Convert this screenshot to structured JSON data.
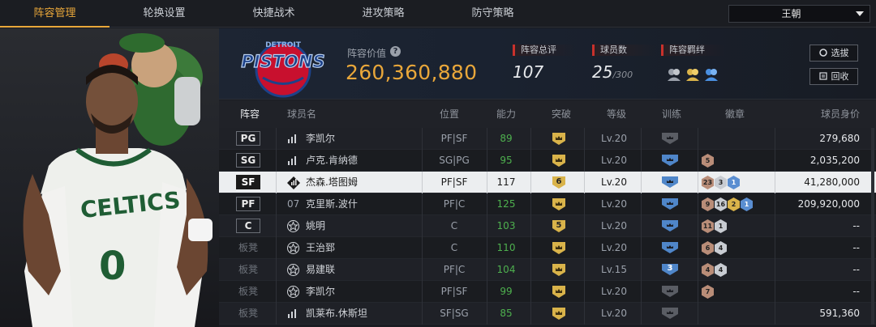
{
  "nav": {
    "tabs": [
      "阵容管理",
      "轮换设置",
      "快捷战术",
      "进攻策略",
      "防守策略"
    ],
    "active_tab": 0,
    "player_select": "王朝"
  },
  "team": {
    "logo_text": "PISTONS",
    "logo_small": "DETROIT"
  },
  "header": {
    "lineup_value_label": "阵容价值",
    "lineup_value": "260,360,880",
    "overall_label": "阵容总评",
    "overall": "107",
    "count_label": "球员数",
    "count": "25",
    "count_max": "/300",
    "bond_label": "阵容羁绊",
    "select_button": "选拔",
    "recycle_button": "回收"
  },
  "columns": {
    "lineup": "阵容",
    "name": "球员名",
    "position": "位置",
    "ability": "能力",
    "breakthrough": "突破",
    "level": "等级",
    "training": "训练",
    "badges": "徽章",
    "value": "球员身价"
  },
  "rows": [
    {
      "slot": "PG",
      "starter": true,
      "icon": "bars",
      "name": "李凯尔",
      "position": "PF|SF",
      "ability": "89",
      "ability_color": "green",
      "breakthrough": "",
      "level": "Lv.20",
      "training": "",
      "training_color": "grey",
      "badges": [],
      "value": "279,680"
    },
    {
      "slot": "SG",
      "starter": true,
      "icon": "bars",
      "name": "卢克.肯纳德",
      "position": "SG|PG",
      "ability": "95",
      "ability_color": "green",
      "breakthrough": "",
      "level": "Lv.20",
      "training": "",
      "training_color": "blue",
      "badges": [
        {
          "t": "5",
          "c": "bronze"
        }
      ],
      "value": "2,035,200"
    },
    {
      "slot": "SF",
      "starter": true,
      "selected": true,
      "icon": "diamond",
      "name": "杰森.塔图姆",
      "position": "PF|SF",
      "ability": "117",
      "ability_color": "white",
      "breakthrough": "6",
      "level": "Lv.20",
      "training": "",
      "training_color": "blue",
      "badges": [
        {
          "t": "23",
          "c": "bronze"
        },
        {
          "t": "3",
          "c": "silver"
        },
        {
          "t": "1",
          "c": "blue"
        }
      ],
      "value": "41,280,000"
    },
    {
      "slot": "PF",
      "starter": true,
      "icon": "07",
      "name": "克里斯.波什",
      "position": "PF|C",
      "ability": "125",
      "ability_color": "green",
      "breakthrough": "",
      "level": "Lv.20",
      "training": "",
      "training_color": "blue",
      "badges": [
        {
          "t": "9",
          "c": "bronze"
        },
        {
          "t": "16",
          "c": "silver"
        },
        {
          "t": "2",
          "c": "gold"
        },
        {
          "t": "1",
          "c": "blue"
        }
      ],
      "value": "209,920,000"
    },
    {
      "slot": "C",
      "starter": true,
      "icon": "star",
      "name": "姚明",
      "position": "C",
      "ability": "103",
      "ability_color": "green",
      "breakthrough": "5",
      "level": "Lv.20",
      "training": "",
      "training_color": "blue",
      "badges": [
        {
          "t": "11",
          "c": "bronze"
        },
        {
          "t": "1",
          "c": "silver"
        }
      ],
      "value": "--"
    },
    {
      "slot": "板凳",
      "starter": false,
      "icon": "star",
      "name": "王治郅",
      "position": "C",
      "ability": "110",
      "ability_color": "green",
      "breakthrough": "",
      "level": "Lv.20",
      "training": "",
      "training_color": "blue",
      "badges": [
        {
          "t": "6",
          "c": "bronze"
        },
        {
          "t": "4",
          "c": "silver"
        }
      ],
      "value": "--"
    },
    {
      "slot": "板凳",
      "starter": false,
      "icon": "star",
      "name": "易建联",
      "position": "PF|C",
      "ability": "104",
      "ability_color": "green",
      "breakthrough": "",
      "level": "Lv.15",
      "training": "3",
      "training_color": "blue",
      "badges": [
        {
          "t": "4",
          "c": "bronze"
        },
        {
          "t": "4",
          "c": "silver"
        }
      ],
      "value": "--"
    },
    {
      "slot": "板凳",
      "starter": false,
      "icon": "star",
      "name": "李凯尔",
      "position": "PF|SF",
      "ability": "99",
      "ability_color": "green",
      "breakthrough": "",
      "level": "Lv.20",
      "training": "",
      "training_color": "grey",
      "badges": [
        {
          "t": "7",
          "c": "bronze"
        }
      ],
      "value": "--"
    },
    {
      "slot": "板凳",
      "starter": false,
      "icon": "bars",
      "name": "凯莱布.休斯坦",
      "position": "SF|SG",
      "ability": "85",
      "ability_color": "green",
      "breakthrough": "",
      "level": "Lv.20",
      "training": "",
      "training_color": "grey",
      "badges": [],
      "value": "591,360"
    }
  ]
}
